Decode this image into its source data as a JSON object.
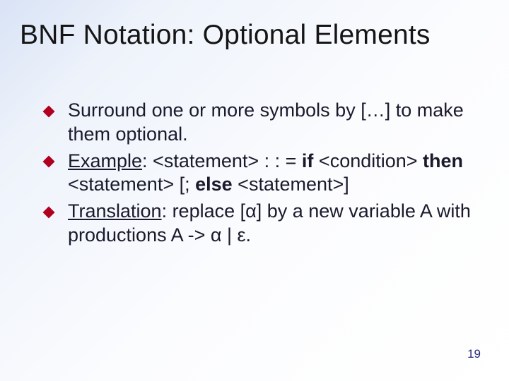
{
  "title": "BNF Notation: Optional Elements",
  "bullets": {
    "b1": {
      "text": "Surround one or more symbols by […] to make them optional."
    },
    "b2": {
      "lead": "Example",
      "seg1": ": <statement> : : = ",
      "kw1": "if",
      "seg2": " <condition> ",
      "kw2": "then",
      "seg3": " <statement> [; ",
      "kw3": "else",
      "seg4": " <statement>]"
    },
    "b3": {
      "lead": "Translation",
      "seg1": ": replace [",
      "alpha1": "α",
      "seg2": "] by a new variable A with productions A -> ",
      "alpha2": "α",
      "seg3": " | ε."
    }
  },
  "page_number": "19"
}
